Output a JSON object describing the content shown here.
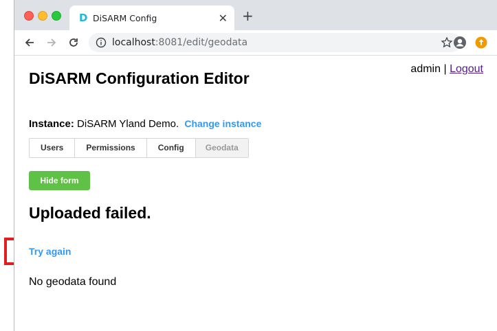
{
  "browser": {
    "tab_title": "DiSARM Config",
    "tab_favicon": "D",
    "tab_close_glyph": "✕",
    "new_tab_glyph": "+",
    "url_host": "localhost",
    "url_rest": ":8081/edit/geodata",
    "icons": [
      "back-icon",
      "forward-icon",
      "reload-icon",
      "info-icon",
      "star-icon",
      "profile-icon",
      "extension-icon"
    ]
  },
  "header": {
    "user": "admin",
    "separator": "|",
    "logout_label": "Logout",
    "title": "DiSARM Configuration Editor"
  },
  "instance": {
    "label": "Instance:",
    "name": "DiSARM Yland Demo.",
    "change_label": "Change instance"
  },
  "tabs": [
    {
      "label": "Users",
      "active": false
    },
    {
      "label": "Permissions",
      "active": false
    },
    {
      "label": "Config",
      "active": false
    },
    {
      "label": "Geodata",
      "active": true
    }
  ],
  "form": {
    "hide_label": "Hide form"
  },
  "status": {
    "message": "Uploaded failed.",
    "retry_label": "Try again",
    "empty_text": "No geodata found"
  },
  "colors": {
    "link": "#3498f0",
    "button_green": "#5fc146",
    "highlight_red": "#e21d1d"
  }
}
